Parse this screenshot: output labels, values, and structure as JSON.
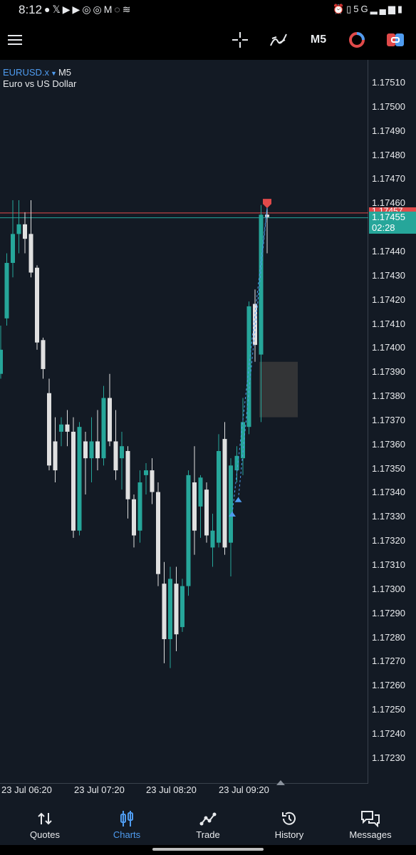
{
  "status_bar": {
    "time": "8:12",
    "left_icons": [
      "spotify-icon",
      "x-icon",
      "youtube-icon",
      "youtube-icon",
      "instagram-icon",
      "instagram-icon",
      "gmail-icon",
      "whatsapp-icon",
      "wifi-icon"
    ],
    "right_icons": [
      "alarm-icon",
      "vibrate-icon",
      "5g-icon",
      "signal-icon",
      "battery-icon"
    ]
  },
  "toolbar": {
    "timeframe": "M5",
    "icons": [
      "menu-icon",
      "crosshair-icon",
      "indicators-icon",
      "clock-icon",
      "trade-icon"
    ]
  },
  "symbol": {
    "name": "EURUSD.x",
    "timeframe": "M5",
    "description": "Euro vs US Dollar"
  },
  "price_axis": [
    "1.17510",
    "1.17500",
    "1.17490",
    "1.17480",
    "1.17470",
    "1.17460",
    "1.17440",
    "1.17430",
    "1.17420",
    "1.17410",
    "1.17400",
    "1.17390",
    "1.17380",
    "1.17370",
    "1.17360",
    "1.17350",
    "1.17340",
    "1.17330",
    "1.17320",
    "1.17310",
    "1.17300",
    "1.17290",
    "1.17280",
    "1.17270",
    "1.17260",
    "1.17250",
    "1.17240",
    "1.17230"
  ],
  "ask_price": "1.17457",
  "bid_price": "1.17455",
  "countdown": "02:28",
  "time_axis": [
    "23 Jul 06:20",
    "23 Jul 07:20",
    "23 Jul 08:20",
    "23 Jul 09:20"
  ],
  "colors": {
    "background": "#131a24",
    "bull": "#26a69a",
    "bear": "#e0e0e0",
    "ask_line": "#e04a4a",
    "bid_line": "#26a69a",
    "accent": "#4f9cf0"
  },
  "chart_data": {
    "type": "candlestick",
    "symbol": "EURUSD.x",
    "timeframe": "M5",
    "y_range": [
      1.17222,
      1.17518
    ],
    "candles": [
      {
        "o": 1.1739,
        "h": 1.1741,
        "l": 1.17388,
        "c": 1.174
      },
      {
        "o": 1.17413,
        "h": 1.1744,
        "l": 1.1741,
        "c": 1.17436
      },
      {
        "o": 1.17436,
        "h": 1.17462,
        "l": 1.1743,
        "c": 1.17448
      },
      {
        "o": 1.17448,
        "h": 1.17462,
        "l": 1.1744,
        "c": 1.17452
      },
      {
        "o": 1.17452,
        "h": 1.17457,
        "l": 1.1744,
        "c": 1.17446
      },
      {
        "o": 1.17448,
        "h": 1.17462,
        "l": 1.1743,
        "c": 1.17432
      },
      {
        "o": 1.17434,
        "h": 1.17435,
        "l": 1.174,
        "c": 1.17403
      },
      {
        "o": 1.17404,
        "h": 1.17405,
        "l": 1.17388,
        "c": 1.17392
      },
      {
        "o": 1.17382,
        "h": 1.17388,
        "l": 1.1735,
        "c": 1.17352
      },
      {
        "o": 1.17362,
        "h": 1.17372,
        "l": 1.17345,
        "c": 1.1735
      },
      {
        "o": 1.17366,
        "h": 1.17372,
        "l": 1.1736,
        "c": 1.17369
      },
      {
        "o": 1.17369,
        "h": 1.17375,
        "l": 1.1736,
        "c": 1.17366
      },
      {
        "o": 1.17366,
        "h": 1.17372,
        "l": 1.17322,
        "c": 1.17325
      },
      {
        "o": 1.17325,
        "h": 1.1737,
        "l": 1.17323,
        "c": 1.17368
      },
      {
        "o": 1.17362,
        "h": 1.17366,
        "l": 1.1734,
        "c": 1.17355
      },
      {
        "o": 1.17355,
        "h": 1.17372,
        "l": 1.17345,
        "c": 1.17362
      },
      {
        "o": 1.17362,
        "h": 1.17375,
        "l": 1.1735,
        "c": 1.17355
      },
      {
        "o": 1.17355,
        "h": 1.17385,
        "l": 1.17352,
        "c": 1.1738
      },
      {
        "o": 1.1738,
        "h": 1.1739,
        "l": 1.1736,
        "c": 1.17362
      },
      {
        "o": 1.17362,
        "h": 1.17375,
        "l": 1.17346,
        "c": 1.1735
      },
      {
        "o": 1.17355,
        "h": 1.17366,
        "l": 1.17342,
        "c": 1.1736
      },
      {
        "o": 1.17358,
        "h": 1.1736,
        "l": 1.1733,
        "c": 1.17338
      },
      {
        "o": 1.17338,
        "h": 1.1734,
        "l": 1.17318,
        "c": 1.17323
      },
      {
        "o": 1.17325,
        "h": 1.1735,
        "l": 1.1732,
        "c": 1.17345
      },
      {
        "o": 1.17348,
        "h": 1.17353,
        "l": 1.1734,
        "c": 1.1735
      },
      {
        "o": 1.1735,
        "h": 1.17355,
        "l": 1.17336,
        "c": 1.17341
      },
      {
        "o": 1.17341,
        "h": 1.17345,
        "l": 1.17302,
        "c": 1.17307
      },
      {
        "o": 1.17303,
        "h": 1.17312,
        "l": 1.1727,
        "c": 1.1728
      },
      {
        "o": 1.1728,
        "h": 1.1731,
        "l": 1.17268,
        "c": 1.17305
      },
      {
        "o": 1.17303,
        "h": 1.1731,
        "l": 1.17275,
        "c": 1.17282
      },
      {
        "o": 1.17285,
        "h": 1.17305,
        "l": 1.17283,
        "c": 1.17302
      },
      {
        "o": 1.17302,
        "h": 1.1735,
        "l": 1.17298,
        "c": 1.17348
      },
      {
        "o": 1.17345,
        "h": 1.1736,
        "l": 1.17315,
        "c": 1.17325
      },
      {
        "o": 1.17335,
        "h": 1.17348,
        "l": 1.17322,
        "c": 1.17347
      },
      {
        "o": 1.17342,
        "h": 1.17345,
        "l": 1.1732,
        "c": 1.17323
      },
      {
        "o": 1.17318,
        "h": 1.17332,
        "l": 1.1731,
        "c": 1.17325
      },
      {
        "o": 1.1732,
        "h": 1.17365,
        "l": 1.17318,
        "c": 1.17358
      },
      {
        "o": 1.17363,
        "h": 1.1737,
        "l": 1.17315,
        "c": 1.17318
      },
      {
        "o": 1.1732,
        "h": 1.17355,
        "l": 1.17306,
        "c": 1.17352
      },
      {
        "o": 1.1735,
        "h": 1.1736,
        "l": 1.17345,
        "c": 1.17356
      },
      {
        "o": 1.17355,
        "h": 1.1738,
        "l": 1.17348,
        "c": 1.1737
      },
      {
        "o": 1.17368,
        "h": 1.1742,
        "l": 1.17365,
        "c": 1.17418
      },
      {
        "o": 1.17419,
        "h": 1.17425,
        "l": 1.17395,
        "c": 1.17402
      },
      {
        "o": 1.17398,
        "h": 1.1746,
        "l": 1.1737,
        "c": 1.17456
      },
      {
        "o": 1.17456,
        "h": 1.1746,
        "l": 1.1744,
        "c": 1.17455
      }
    ],
    "ask": 1.17457,
    "bid": 1.17455,
    "trade_markers": [
      {
        "type": "buy",
        "price": 1.17332
      },
      {
        "type": "buy",
        "price": 1.17338
      },
      {
        "type": "sell",
        "price": 1.17459
      }
    ],
    "highlight_zone": {
      "y_top": 1.17395,
      "y_bottom": 1.17372
    }
  },
  "bottom_nav": [
    {
      "label": "Quotes",
      "icon": "quotes-icon",
      "active": false
    },
    {
      "label": "Charts",
      "icon": "charts-icon",
      "active": true
    },
    {
      "label": "Trade",
      "icon": "trade-chart-icon",
      "active": false
    },
    {
      "label": "History",
      "icon": "history-icon",
      "active": false
    },
    {
      "label": "Messages",
      "icon": "messages-icon",
      "active": false
    }
  ]
}
